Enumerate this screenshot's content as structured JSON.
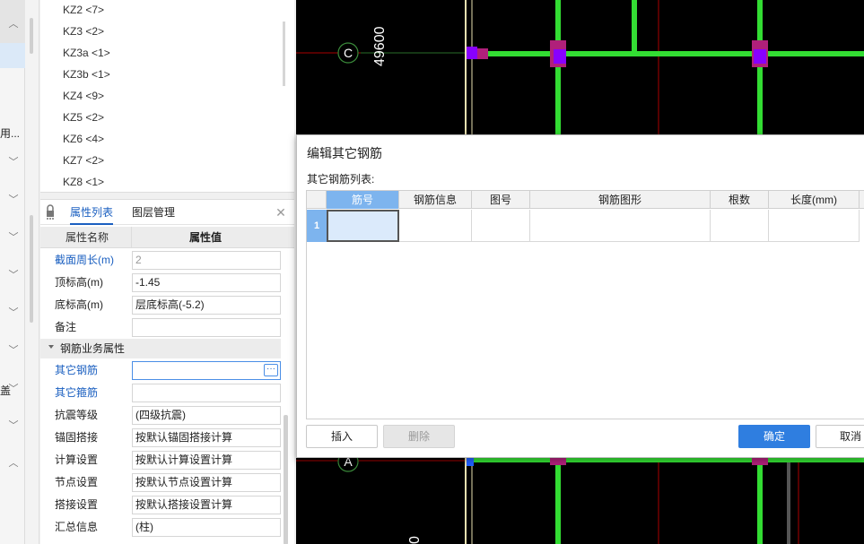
{
  "left_strip": {
    "fragments": [
      "用...",
      "盖"
    ]
  },
  "component_list": {
    "items": [
      "KZ2 <7>",
      "KZ3 <2>",
      "KZ3a <1>",
      "KZ3b <1>",
      "KZ4 <9>",
      "KZ5 <2>",
      "KZ6 <4>",
      "KZ7 <2>",
      "KZ8 <1>"
    ]
  },
  "prop_panel": {
    "tabs": [
      "属性列表",
      "图层管理"
    ],
    "header": {
      "name": "属性名称",
      "value": "属性值"
    },
    "rows": [
      {
        "name": "截面周长(m)",
        "value": "2"
      },
      {
        "name": "顶标高(m)",
        "value": "-1.45"
      },
      {
        "name": "底标高(m)",
        "value": "层底标高(-5.2)"
      },
      {
        "name": "备注",
        "value": ""
      }
    ],
    "group": "钢筋业务属性",
    "group_rows": [
      {
        "name": "其它钢筋",
        "value": ""
      },
      {
        "name": "其它箍筋",
        "value": ""
      },
      {
        "name": "抗震等级",
        "value": "(四级抗震)"
      },
      {
        "name": "锚固搭接",
        "value": "按默认锚固搭接计算"
      },
      {
        "name": "计算设置",
        "value": "按默认计算设置计算"
      },
      {
        "name": "节点设置",
        "value": "按默认节点设置计算"
      },
      {
        "name": "搭接设置",
        "value": "按默认搭接设置计算"
      },
      {
        "name": "汇总信息",
        "value": "(柱)"
      }
    ],
    "ellipsis": "···"
  },
  "cad": {
    "axis_c": "C",
    "axis_a": "A",
    "dim_top": "49600",
    "dim_bottom": "0"
  },
  "dialog": {
    "title": "编辑其它钢筋",
    "list_label": "其它钢筋列表:",
    "columns": [
      "筋号",
      "钢筋信息",
      "图号",
      "钢筋图形",
      "根数",
      "长度(mm)"
    ],
    "row_number": "1",
    "buttons": {
      "insert": "插入",
      "delete": "删除",
      "ok": "确定",
      "cancel": "取消"
    }
  },
  "colors": {
    "accent": "#2f7ee0",
    "link": "#1a5fc0",
    "cad_beam": "#33dd33",
    "cad_column": "#b0207a",
    "cad_node": "#8800ff",
    "cad_grid": "#cc0000"
  }
}
